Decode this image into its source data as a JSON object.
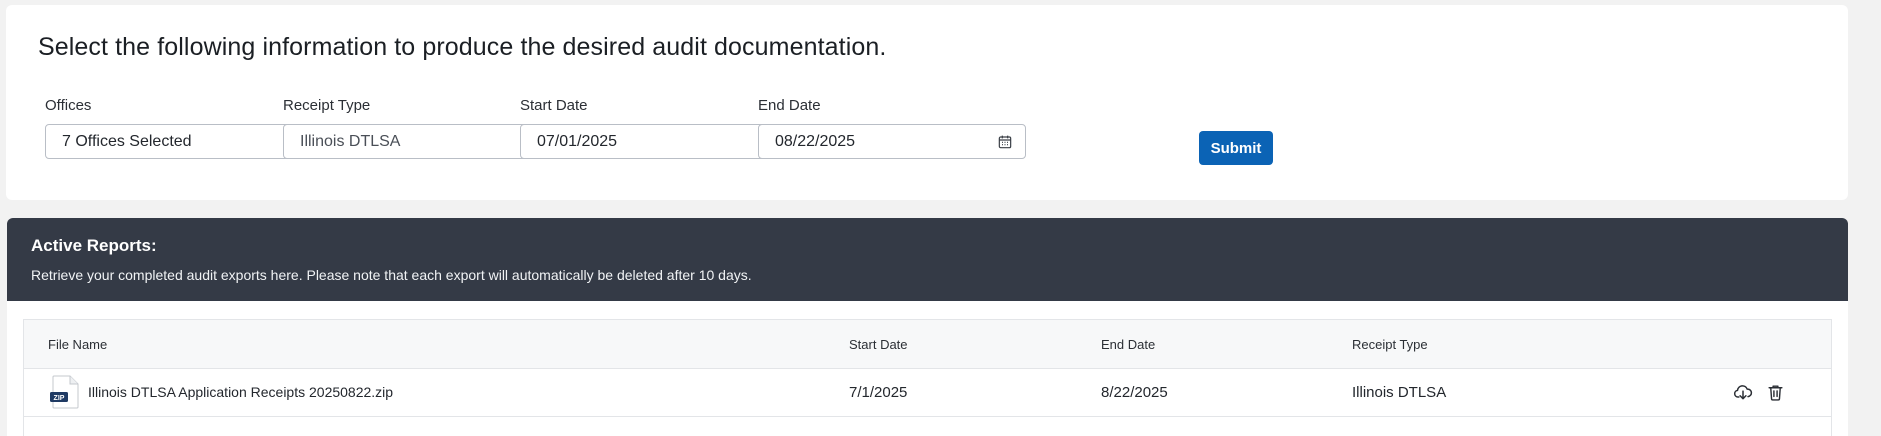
{
  "form": {
    "heading": "Select the following information to produce the desired audit documentation.",
    "offices": {
      "label": "Offices",
      "value": "7 Offices Selected",
      "icon": "pencil-icon"
    },
    "receipt_type": {
      "label": "Receipt Type",
      "value": "Illinois DTLSA",
      "icon": "chevron-down-icon"
    },
    "start_date": {
      "label": "Start Date",
      "value": "07/01/2025",
      "icon": "calendar-icon"
    },
    "end_date": {
      "label": "End Date",
      "value": "08/22/2025",
      "icon": "calendar-icon"
    },
    "submit_label": "Submit"
  },
  "reports": {
    "title": "Active Reports:",
    "description": "Retrieve your completed audit exports here. Please note that each export will automatically be deleted after 10 days.",
    "columns": [
      "File Name",
      "Start Date",
      "End Date",
      "Receipt Type"
    ],
    "rows": [
      {
        "file_icon": "zip-file-icon",
        "file_badge": "ZIP",
        "file_name": "Illinois DTLSA Application Receipts 20250822.zip",
        "start_date": "7/1/2025",
        "end_date": "8/22/2025",
        "receipt_type": "Illinois DTLSA",
        "actions": [
          "download-icon",
          "trash-icon"
        ]
      }
    ]
  },
  "colors": {
    "primary_button": "#0b63b5",
    "reports_header_bg": "#343a46",
    "page_bg": "#f2f2f2"
  }
}
